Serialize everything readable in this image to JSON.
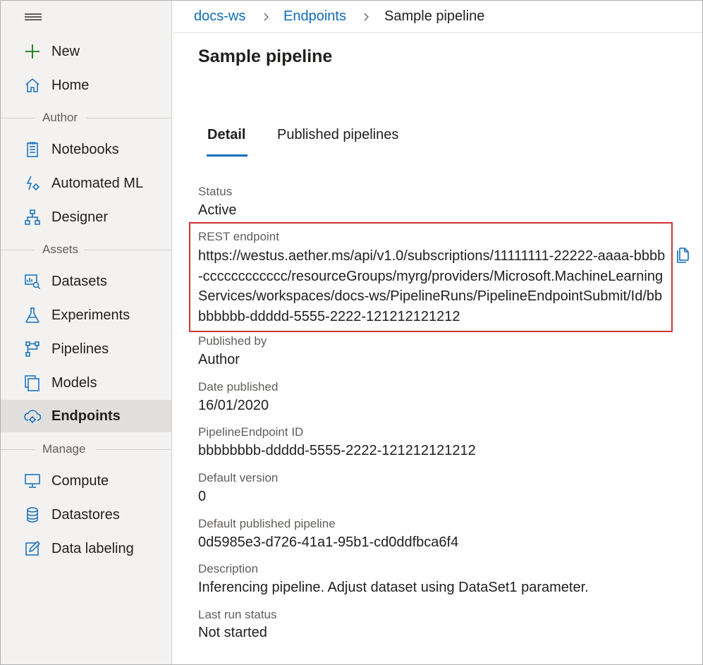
{
  "sidebar": {
    "new_label": "New",
    "home_label": "Home",
    "sections": {
      "author": "Author",
      "assets": "Assets",
      "manage": "Manage"
    },
    "author_items": [
      {
        "label": "Notebooks",
        "icon": "notebook-icon"
      },
      {
        "label": "Automated ML",
        "icon": "automated-ml-icon"
      },
      {
        "label": "Designer",
        "icon": "designer-icon"
      }
    ],
    "asset_items": [
      {
        "label": "Datasets",
        "icon": "dataset-icon"
      },
      {
        "label": "Experiments",
        "icon": "flask-icon"
      },
      {
        "label": "Pipelines",
        "icon": "pipeline-icon"
      },
      {
        "label": "Models",
        "icon": "models-icon"
      },
      {
        "label": "Endpoints",
        "icon": "endpoint-icon",
        "active": true
      }
    ],
    "manage_items": [
      {
        "label": "Compute",
        "icon": "monitor-icon"
      },
      {
        "label": "Datastores",
        "icon": "database-icon"
      },
      {
        "label": "Data labeling",
        "icon": "edit-icon"
      }
    ]
  },
  "breadcrumb": {
    "workspace": "docs-ws",
    "section": "Endpoints",
    "current": "Sample pipeline"
  },
  "page": {
    "title": "Sample pipeline"
  },
  "tabs": {
    "detail": "Detail",
    "published": "Published pipelines"
  },
  "details": {
    "status_label": "Status",
    "status_value": "Active",
    "rest_label": "REST endpoint",
    "rest_value": "https://westus.aether.ms/api/v1.0/subscriptions/11111111-22222-aaaa-bbbb-cccccccccccc/resourceGroups/myrg/providers/Microsoft.MachineLearningServices/workspaces/docs-ws/PipelineRuns/PipelineEndpointSubmit/Id/bbbbbbbb-ddddd-5555-2222-121212121212",
    "published_by_label": "Published by",
    "published_by_value": "Author",
    "date_label": "Date published",
    "date_value": "16/01/2020",
    "endpoint_id_label": "PipelineEndpoint ID",
    "endpoint_id_value": "bbbbbbbb-ddddd-5555-2222-121212121212",
    "default_version_label": "Default version",
    "default_version_value": "0",
    "default_pipeline_label": "Default published pipeline",
    "default_pipeline_value": "0d5985e3-d726-41a1-95b1-cd0ddfbca6f4",
    "description_label": "Description",
    "description_value": "Inferencing pipeline. Adjust dataset using DataSet1 parameter.",
    "last_run_label": "Last run status",
    "last_run_value": "Not started"
  },
  "colors": {
    "accent": "#0f6cbd",
    "highlight": "#d13438",
    "new_icon": "#107c10",
    "sidebar_bg": "#f3f2f1",
    "active_bg": "#e1dfdd"
  }
}
